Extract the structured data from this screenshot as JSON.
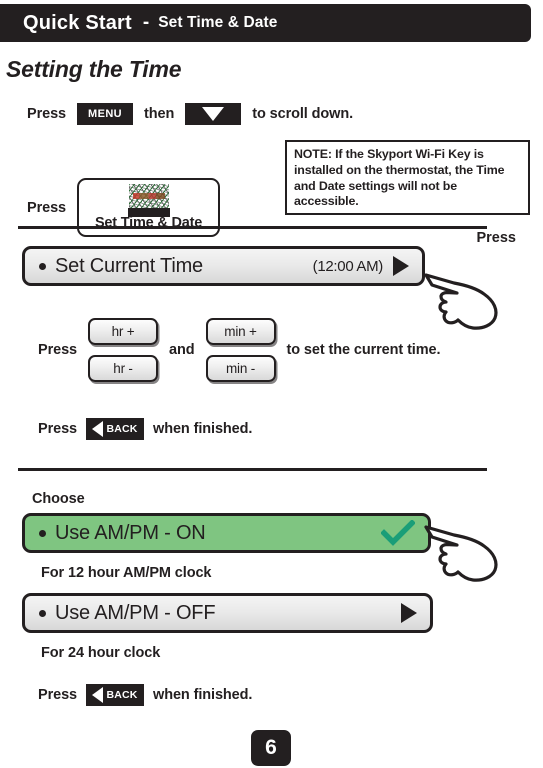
{
  "header": {
    "title": "Quick Start",
    "separator": "-",
    "subtitle": "Set Time & Date"
  },
  "section": {
    "heading": "Setting the Time"
  },
  "steps": {
    "menu_row": {
      "press_label": "Press",
      "menu_key": "MENU",
      "then_label": "then",
      "scroll_icon": "down-arrow-icon",
      "tail_label": "to scroll down."
    },
    "settime_row": {
      "press_label": "Press",
      "tile_label": "Set Time & Date",
      "tile_icon": "clock-screen-icon"
    },
    "hrmin_row": {
      "press_label": "Press",
      "hr_plus": "hr +",
      "hr_minus": "hr -",
      "and_label": "and",
      "min_plus": "min +",
      "min_minus": "min -",
      "tail_label": "to set the current time."
    },
    "back_row_1": {
      "press_label": "Press",
      "back_key": "BACK",
      "tail_label": "when finished."
    },
    "back_row_2": {
      "press_label": "Press",
      "back_key": "BACK",
      "tail_label": "when finished."
    }
  },
  "note": {
    "text": "NOTE: If the Skyport Wi-Fi Key is installed on the thermostat, the Time and Date settings will not be accessible."
  },
  "press_pointer": {
    "label": "Press"
  },
  "thermostat_bars": {
    "set_current_time": {
      "bullet": "•",
      "label": "Set Current Time",
      "value": "(12:00 AM)",
      "arrow_icon": "right-triangle-icon"
    },
    "ampm_on": {
      "bullet": "•",
      "label": "Use AM/PM - ON",
      "check_icon": "checkmark-icon",
      "selected": true
    },
    "ampm_off": {
      "bullet": "•",
      "label": "Use AM/PM - OFF",
      "arrow_icon": "right-triangle-icon",
      "selected": false
    }
  },
  "choose_section": {
    "choose_label": "Choose",
    "caption_12h": "For 12 hour AM/PM clock",
    "caption_24h": "For 24 hour clock"
  },
  "footer": {
    "page_number": "6"
  },
  "colors": {
    "ink": "#231f20",
    "paper": "#ffffff",
    "highlight_green": "#7fc581",
    "check_green": "#1a9e78",
    "bar_gray_top": "#f4f4f4",
    "bar_gray_bottom": "#d8d8d8"
  }
}
